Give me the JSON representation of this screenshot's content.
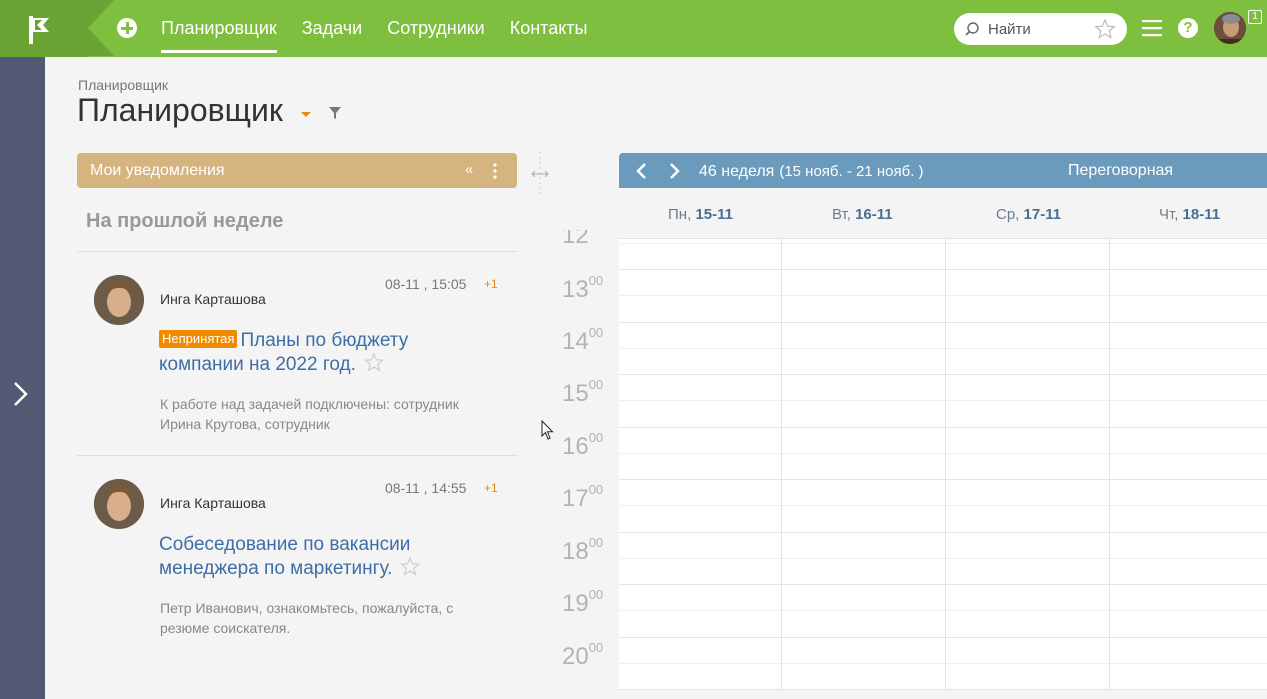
{
  "topbar": {
    "nav": [
      "Планировщик",
      "Задачи",
      "Сотрудники",
      "Контакты"
    ],
    "active_nav": "Планировщик",
    "search_placeholder": "Найти",
    "notification_count": "1",
    "colors": {
      "bar": "#7fbf3f",
      "logo": "#6aa334"
    }
  },
  "page": {
    "breadcrumb": "Планировщик",
    "title": "Планировщик"
  },
  "notifications": {
    "header": "Мои уведомления",
    "collapse_label": "«",
    "section": "На прошлой неделе",
    "items": [
      {
        "author": "Инга Карташова",
        "time": "08-11 , 15:05",
        "count": "+1",
        "tag": "Непринятая",
        "title": "Планы по бюджету компании на 2022 год.",
        "description": "К работе над задачей подключены: сотрудник Ирина Крутова, сотрудник"
      },
      {
        "author": "Инга Карташова",
        "time": "08-11 , 14:55",
        "count": "+1",
        "tag": "",
        "title": "Собеседование по вакансии менеджера по маркетингу.",
        "description": "Петр Иванович, ознакомьтесь, пожалуйста, с резюме соискателя."
      }
    ]
  },
  "scheduler": {
    "week": "46 неделя",
    "range": "(15 нояб. - 21 нояб. )",
    "room": "Переговорная",
    "days": [
      {
        "name": "Пн,",
        "date": "15-11"
      },
      {
        "name": "Вт,",
        "date": "16-11"
      },
      {
        "name": "Ср,",
        "date": "17-11"
      },
      {
        "name": "Чт,",
        "date": "18-11"
      }
    ],
    "hours": [
      {
        "h": "12",
        "m": ""
      },
      {
        "h": "13",
        "m": "00"
      },
      {
        "h": "14",
        "m": "00"
      },
      {
        "h": "15",
        "m": "00"
      },
      {
        "h": "16",
        "m": "00"
      },
      {
        "h": "17",
        "m": "00"
      },
      {
        "h": "18",
        "m": "00"
      },
      {
        "h": "19",
        "m": "00"
      },
      {
        "h": "20",
        "m": "00"
      }
    ]
  }
}
